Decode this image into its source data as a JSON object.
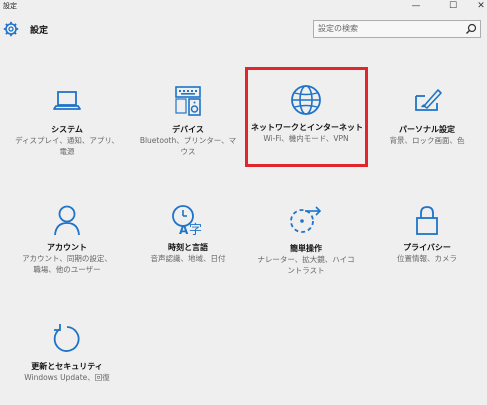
{
  "window": {
    "title": "設定",
    "minimize_glyph": "—",
    "maximize_glyph": "☐",
    "close_glyph": "✕"
  },
  "header": {
    "title": "設定",
    "search_placeholder": "設定の検索"
  },
  "tiles": [
    {
      "key": "system",
      "label": "システム",
      "desc_lines": [
        "ディスプレイ、通知、アプリ、",
        "電源"
      ],
      "icon": "laptop-icon"
    },
    {
      "key": "devices",
      "label": "デバイス",
      "desc_lines": [
        "Bluetooth、プリンター、マ",
        "ウス"
      ],
      "icon": "keyboard-speaker-icon"
    },
    {
      "key": "network",
      "label": "ネットワークとインターネット",
      "desc_lines": [
        "Wi-Fi、機内モード、VPN"
      ],
      "icon": "globe-icon",
      "highlighted": true
    },
    {
      "key": "personalization",
      "label": "パーソナル設定",
      "desc_lines": [
        "背景、ロック画面、色"
      ],
      "icon": "paint-screen-icon"
    },
    {
      "key": "accounts",
      "label": "アカウント",
      "desc_lines": [
        "アカウント、同期の設定、",
        "職場、他のユーザー"
      ],
      "icon": "person-icon"
    },
    {
      "key": "time-language",
      "label": "時刻と言語",
      "desc_lines": [
        "音声認識、地域、日付"
      ],
      "icon": "clock-language-icon"
    },
    {
      "key": "ease-of-access",
      "label": "簡単操作",
      "desc_lines": [
        "ナレーター、拡大鏡、ハイコ",
        "ントラスト"
      ],
      "icon": "ease-of-access-icon"
    },
    {
      "key": "privacy",
      "label": "プライバシー",
      "desc_lines": [
        "位置情報、カメラ"
      ],
      "icon": "lock-icon"
    },
    {
      "key": "update-security",
      "label": "更新とセキュリティ",
      "desc_lines": [
        "Windows Update、回復"
      ],
      "icon": "refresh-icon"
    }
  ],
  "colors": {
    "accent": "#1f74c9",
    "highlight": "#e0262c"
  }
}
